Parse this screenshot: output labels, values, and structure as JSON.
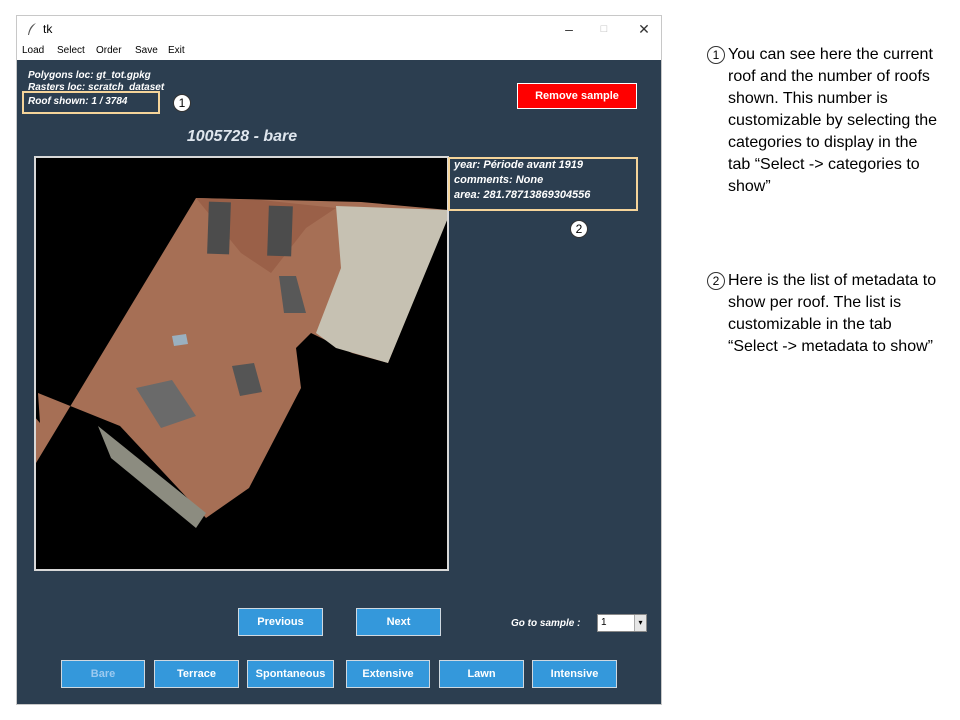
{
  "window": {
    "title": "tk",
    "controls": {
      "minimize": "–",
      "maximize": "□",
      "close": "✕"
    }
  },
  "menu": {
    "items": [
      "Load",
      "Select",
      "Order",
      "Save",
      "Exit"
    ]
  },
  "info": {
    "polygons": "Polygons loc: gt_tot.gpkg",
    "rasters": "Rasters loc: scratch_dataset",
    "roof_shown": "Roof shown: 1 / 3784"
  },
  "remove_button": "Remove sample",
  "sample_title": "1005728 - bare",
  "metadata": {
    "year": "year: Période avant 1919",
    "comments": "comments: None",
    "area": "area: 281.78713869304556"
  },
  "markers": {
    "one": "1",
    "two": "2"
  },
  "nav": {
    "previous": "Previous",
    "next": "Next"
  },
  "goto": {
    "label": "Go to sample :",
    "value": "1",
    "arrow": "▾"
  },
  "categories": {
    "bare": "Bare",
    "terrace": "Terrace",
    "spontaneous": "Spontaneous",
    "extensive": "Extensive",
    "lawn": "Lawn",
    "intensive": "Intensive"
  },
  "annotations": {
    "first": "You can see here the current roof and the number of roofs shown. This number is customizable by selecting the categories to display in the tab “Select -> categories to show”",
    "second": "Here is the list of metadata to show per roof. The list is customizable in the tab “Select -> metadata to show”"
  },
  "colors": {
    "app_background": "#2c3e50",
    "button_blue": "#3498db",
    "remove_red": "#ff0000",
    "highlight": "#f5d49a"
  }
}
